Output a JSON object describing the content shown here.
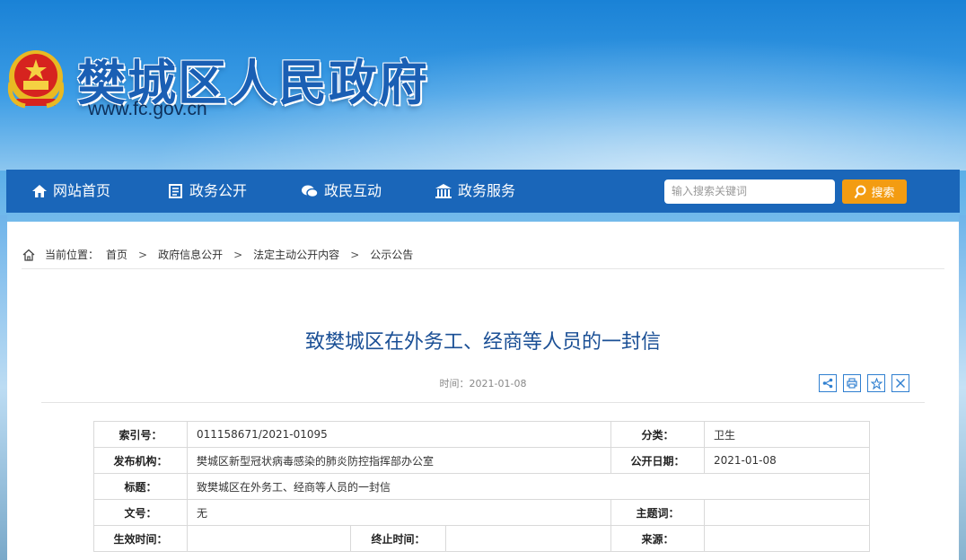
{
  "site": {
    "title": "樊城区人民政府",
    "url": "www.fc.gov.cn"
  },
  "nav": {
    "items": [
      {
        "label": "网站首页",
        "icon": "home-icon"
      },
      {
        "label": "政务公开",
        "icon": "document-icon"
      },
      {
        "label": "政民互动",
        "icon": "chat-icon"
      },
      {
        "label": "政务服务",
        "icon": "building-icon"
      }
    ],
    "search_placeholder": "输入搜索关键词",
    "search_label": "搜索"
  },
  "breadcrumb": {
    "prefix": "当前位置：",
    "items": [
      "首页",
      "政府信息公开",
      "法定主动公开内容",
      "公示公告"
    ],
    "separator": ">"
  },
  "article": {
    "title": "致樊城区在外务工、经商等人员的一封信",
    "date": "时间：2021-01-08",
    "tools": [
      "share-icon",
      "print-icon",
      "favorite-icon",
      "close-icon"
    ]
  },
  "meta": {
    "index_label": "索引号：",
    "index_value": "011158671/2021-01095",
    "category_label": "分类：",
    "category_value": "卫生",
    "publisher_label": "发布机构：",
    "publisher_value": "樊城区新型冠状病毒感染的肺炎防控指挥部办公室",
    "pubdate_label": "公开日期：",
    "pubdate_value": "2021-01-08",
    "subject_label": "标题：",
    "subject_value": "致樊城区在外务工、经商等人员的一封信",
    "docno_label": "文号：",
    "docno_value": "无",
    "keywords_label": "主题词：",
    "keywords_value": "",
    "effective_label": "生效时间：",
    "effective_value": "",
    "expire_label": "终止时间：",
    "expire_value": "",
    "source_label": "来源：",
    "source_value": ""
  },
  "colors": {
    "nav_bg": "#1a66b9",
    "title_blue": "#1a4f95",
    "search_button": "#f39c12"
  }
}
